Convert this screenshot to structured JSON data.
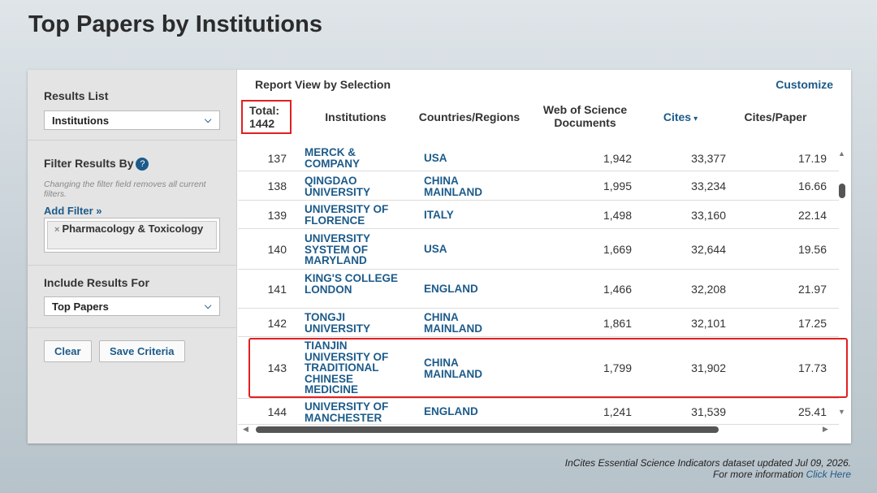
{
  "page_title": "Top Papers by Institutions",
  "sidebar": {
    "results_list_title": "Results List",
    "results_list_value": "Institutions",
    "filter_title": "Filter Results By",
    "help_glyph": "?",
    "filter_note": "Changing the filter field removes all current filters.",
    "add_filter": "Add Filter »",
    "filter_chip_x": "×",
    "filter_chip": "Pharmacology & Toxicology",
    "include_title": "Include Results For",
    "include_value": "Top Papers",
    "clear_button": "Clear",
    "save_button": "Save Criteria"
  },
  "main": {
    "report_view": "Report View by Selection",
    "customize": "Customize",
    "headers": {
      "total_label": "Total:",
      "total_value": "1442",
      "institutions": "Institutions",
      "countries": "Countries/Regions",
      "wos_documents": "Web of Science Documents",
      "cites": "Cites",
      "cites_paper": "Cites/Paper"
    },
    "rows": [
      {
        "rank": "137",
        "institution": "MERCK & COMPANY",
        "country": "USA",
        "docs": "1,942",
        "cites": "33,377",
        "cites_paper": "17.19"
      },
      {
        "rank": "138",
        "institution": "QINGDAO UNIVERSITY",
        "country": "CHINA MAINLAND",
        "docs": "1,995",
        "cites": "33,234",
        "cites_paper": "16.66"
      },
      {
        "rank": "139",
        "institution": "UNIVERSITY OF FLORENCE",
        "country": "ITALY",
        "docs": "1,498",
        "cites": "33,160",
        "cites_paper": "22.14"
      },
      {
        "rank": "140",
        "institution": "UNIVERSITY SYSTEM OF MARYLAND",
        "country": "USA",
        "docs": "1,669",
        "cites": "32,644",
        "cites_paper": "19.56"
      },
      {
        "rank": "141",
        "institution": "KING'S COLLEGE LONDON",
        "country": "ENGLAND",
        "docs": "1,466",
        "cites": "32,208",
        "cites_paper": "21.97"
      },
      {
        "rank": "142",
        "institution": "TONGJI UNIVERSITY",
        "country": "CHINA MAINLAND",
        "docs": "1,861",
        "cites": "32,101",
        "cites_paper": "17.25"
      },
      {
        "rank": "143",
        "institution": "TIANJIN UNIVERSITY OF TRADITIONAL CHINESE MEDICINE",
        "country": "CHINA MAINLAND",
        "docs": "1,799",
        "cites": "31,902",
        "cites_paper": "17.73"
      },
      {
        "rank": "144",
        "institution": "UNIVERSITY OF MANCHESTER",
        "country": "ENGLAND",
        "docs": "1,241",
        "cites": "31,539",
        "cites_paper": "25.41"
      }
    ]
  },
  "footer": {
    "line1": "InCites Essential Science Indicators dataset updated Jul 09, 2026.",
    "line2_prefix": "For more information",
    "line2_link": "Click Here"
  },
  "colors": {
    "link_blue": "#1c5b8a",
    "highlight_red": "#e02020"
  }
}
